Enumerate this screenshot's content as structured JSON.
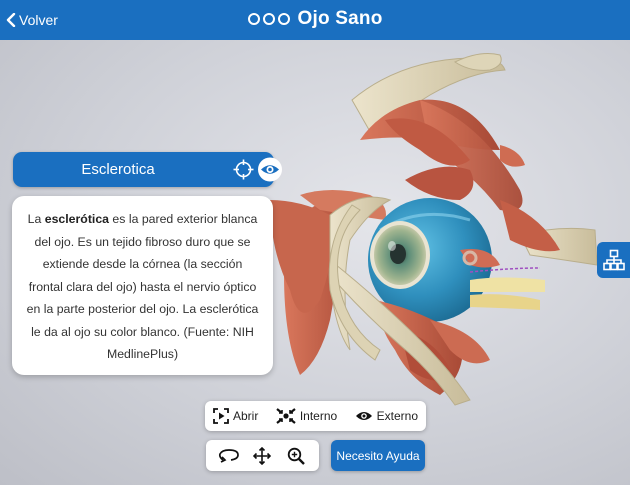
{
  "header": {
    "back_label": "Volver",
    "title": "Ojo Sano"
  },
  "structure": {
    "name": "Esclerotica"
  },
  "description": {
    "prefix": "La ",
    "term": "esclerótica",
    "body": " es la pared exterior blanca del ojo. Es un tejido fibroso duro que se extiende desde la córnea (la sección frontal clara del ojo) hasta el nervio óptico en la parte posterior del ojo. La esclerótica le da al ojo su color blanco. (Fuente: NIH MedlinePlus)"
  },
  "toolbar": {
    "open_label": "Abrir",
    "internal_label": "Interno",
    "external_label": "Externo"
  },
  "help": {
    "label": "Necesito Ayuda"
  },
  "colors": {
    "brand_blue": "#1a6fc0",
    "muscle": "#c4614a",
    "iris": "#4a7a70",
    "sclera": "#3aa0c8"
  },
  "icons": {
    "back": "chevron-left-icon",
    "target": "crosshair-icon",
    "eye": "eye-icon",
    "network": "hierarchy-icon",
    "open": "play-square-icon",
    "internal": "collapse-icon",
    "external": "eye-icon",
    "rotate": "rotate-icon",
    "pan": "move-icon",
    "zoom": "zoom-icon"
  }
}
